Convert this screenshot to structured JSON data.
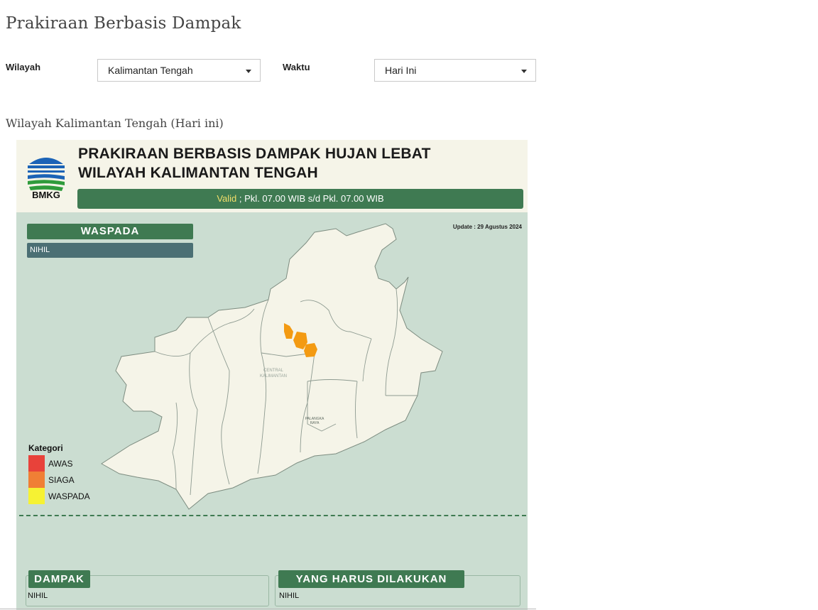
{
  "page": {
    "title": "Prakiraan Berbasis Dampak",
    "subtitle": "Wilayah Kalimantan Tengah (Hari ini)"
  },
  "filters": {
    "wilayah_label": "Wilayah",
    "wilayah_value": "Kalimantan Tengah",
    "waktu_label": "Waktu",
    "waktu_value": "Hari Ini"
  },
  "infographic": {
    "logo_text": "BMKG",
    "title_line1": "PRAKIRAAN BERBASIS DAMPAK HUJAN LEBAT",
    "title_line2": "WILAYAH KALIMANTAN TENGAH",
    "valid_word": "Valid",
    "valid_rest": " ; Pkl. 07.00 WIB s/d Pkl. 07.00 WIB",
    "update": "Update : 29 Agustus 2024",
    "waspada_title": "WASPADA",
    "waspada_value": "NIHIL",
    "map_label_1a": "CENTRAL",
    "map_label_1b": "KALIMANTAN",
    "map_label_2a": "PALANGKA",
    "map_label_2b": "RAYA",
    "legend": {
      "title": "Kategori",
      "items": [
        {
          "label": "AWAS",
          "color": "#e8423a"
        },
        {
          "label": "SIAGA",
          "color": "#f07f35"
        },
        {
          "label": "WASPADA",
          "color": "#f6f233"
        }
      ]
    },
    "dampak_title": "DAMPAK",
    "dampak_value": "NIHIL",
    "yhd_title": "YANG HARUS DILAKUKAN",
    "yhd_value": "NIHIL"
  },
  "colors": {
    "brand_green": "#3f7a52",
    "map_background": "#cbddd1",
    "land": "#f5f4e8",
    "highlight_orange": "#f39a12"
  }
}
